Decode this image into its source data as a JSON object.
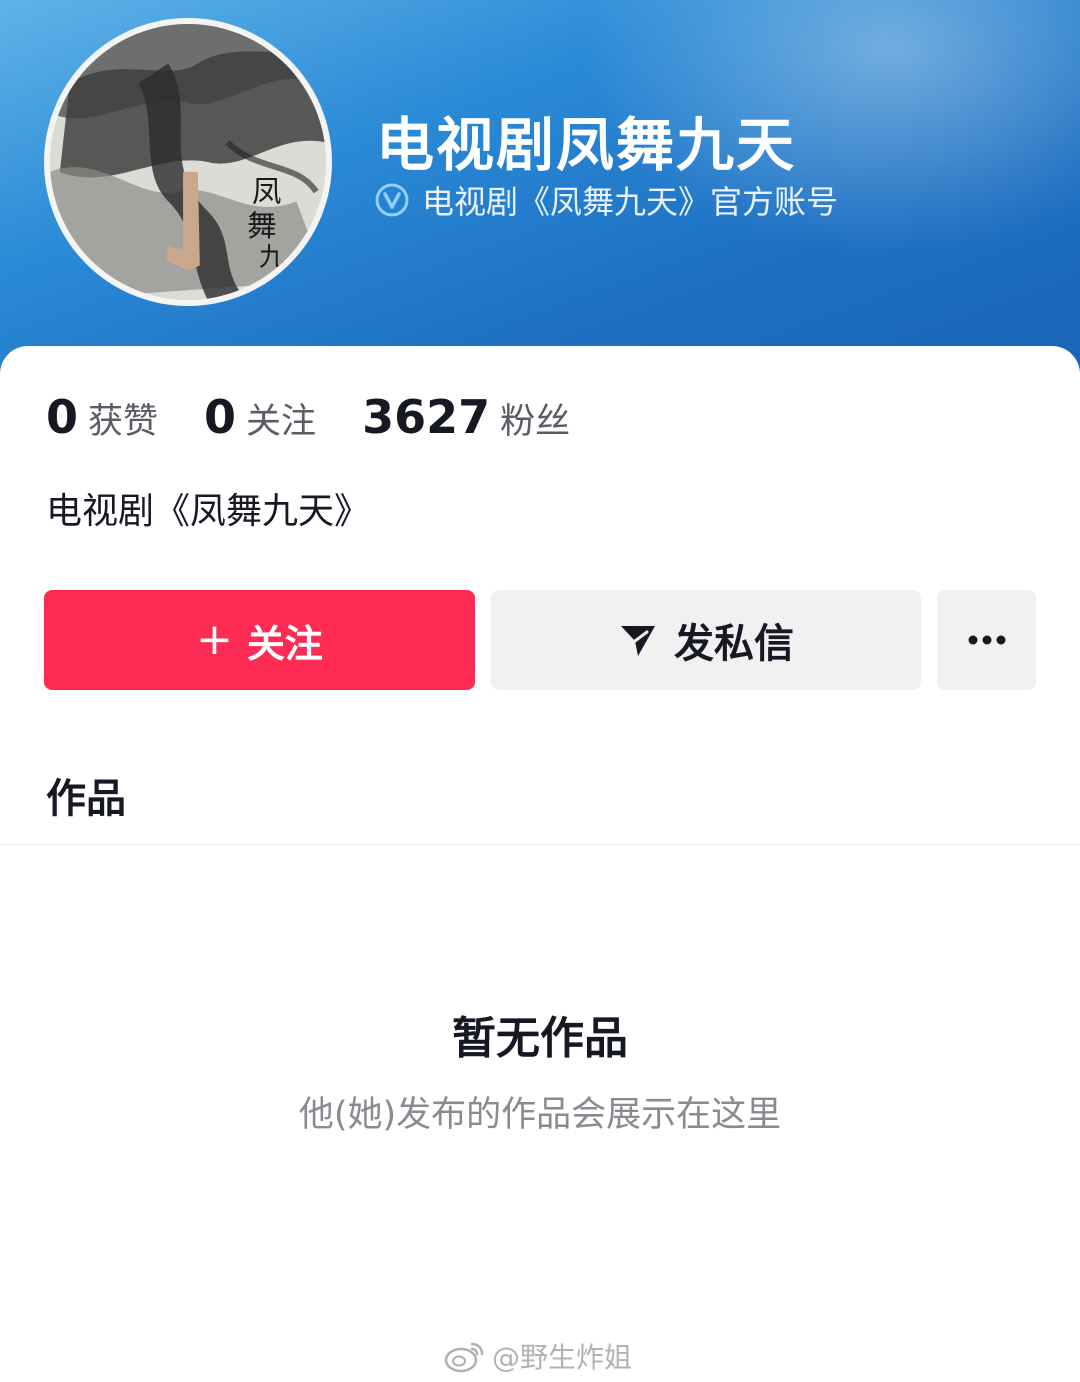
{
  "profile": {
    "name": "电视剧凤舞九天",
    "verified_text": "电视剧《凤舞九天》官方账号",
    "avatar_text": "凤舞九天"
  },
  "stats": [
    {
      "value": "0",
      "label": "获赞"
    },
    {
      "value": "0",
      "label": "关注"
    },
    {
      "value": "3627",
      "label": "粉丝"
    }
  ],
  "bio": "电视剧《凤舞九天》",
  "actions": {
    "follow_plus": "+",
    "follow_label": "关注",
    "message_label": "发私信"
  },
  "tabs": {
    "works_label": "作品"
  },
  "empty_state": {
    "title": "暂无作品",
    "subtitle": "他(她)发布的作品会展示在这里"
  },
  "watermark": {
    "text": "@野生炸姐"
  },
  "colors": {
    "banner": "#1d6fc2",
    "follow_button": "#fe2c55",
    "secondary_button": "#f1f1f2",
    "text_primary": "#161823",
    "text_secondary": "#8a8b91"
  },
  "icons": {
    "verified": "verified-v-icon",
    "message": "send-arrow-icon",
    "more": "more-dots-icon",
    "watermark": "weibo-icon"
  }
}
